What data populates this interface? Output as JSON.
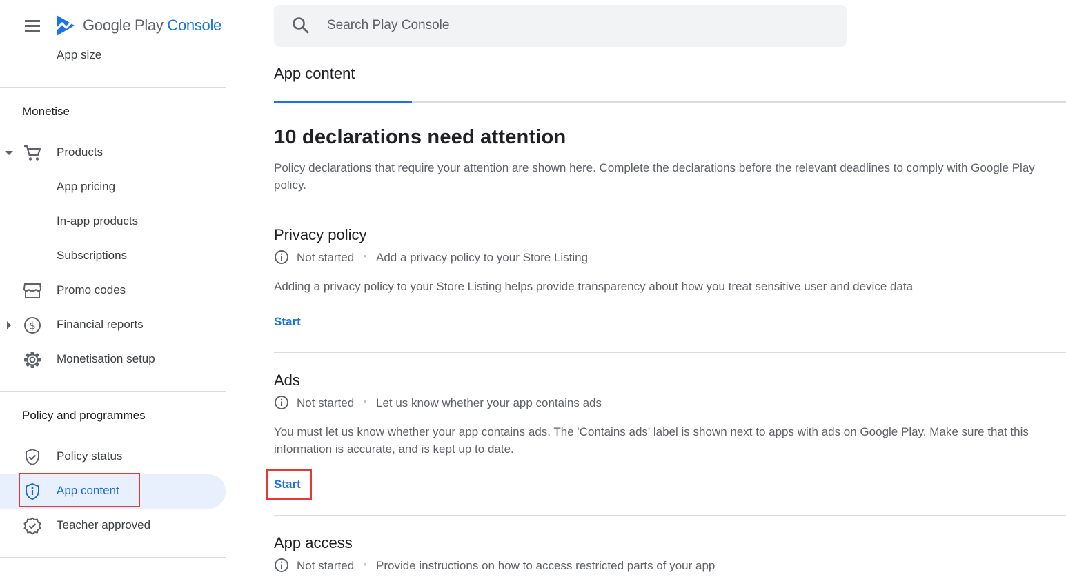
{
  "header": {
    "logo_google_play": "Google Play",
    "logo_console": "Console",
    "search_placeholder": "Search Play Console"
  },
  "sidebar": {
    "top_item": "App size",
    "monetise": {
      "title": "Monetise",
      "items": [
        {
          "label": "Products",
          "icon": "cart-icon"
        },
        {
          "label": "App pricing"
        },
        {
          "label": "In-app products"
        },
        {
          "label": "Subscriptions"
        },
        {
          "label": "Promo codes",
          "icon": "store-icon"
        },
        {
          "label": "Financial reports",
          "icon": "dollar-icon"
        },
        {
          "label": "Monetisation setup",
          "icon": "gear-icon"
        }
      ]
    },
    "policy": {
      "title": "Policy and programmes",
      "items": [
        {
          "label": "Policy status",
          "icon": "shield-check-icon"
        },
        {
          "label": "App content",
          "icon": "shield-info-icon",
          "active": true
        },
        {
          "label": "Teacher approved",
          "icon": "badge-check-icon"
        }
      ]
    }
  },
  "main": {
    "page_title": "App content",
    "heading": "10 declarations need attention",
    "intro": "Policy declarations that require your attention are shown here. Complete the declarations before the relevant deadlines to comply with Google Play policy.",
    "declarations": [
      {
        "title": "Privacy policy",
        "status": "Not started",
        "summary": "Add a privacy policy to your Store Listing",
        "body": "Adding a privacy policy to your Store Listing helps provide transparency about how you treat sensitive user and device data",
        "action": "Start"
      },
      {
        "title": "Ads",
        "status": "Not started",
        "summary": "Let us know whether your app contains ads",
        "body": "You must let us know whether your app contains ads. The 'Contains ads' label is shown next to apps with ads on Google Play. Make sure that this information is accurate, and is kept up to date.",
        "action": "Start"
      },
      {
        "title": "App access",
        "status": "Not started",
        "summary": "Provide instructions on how to access restricted parts of your app"
      }
    ],
    "separator": "•"
  },
  "colors": {
    "accent": "#1a73e8",
    "active_bg": "#e8f0fe",
    "highlight": "#e53935"
  }
}
